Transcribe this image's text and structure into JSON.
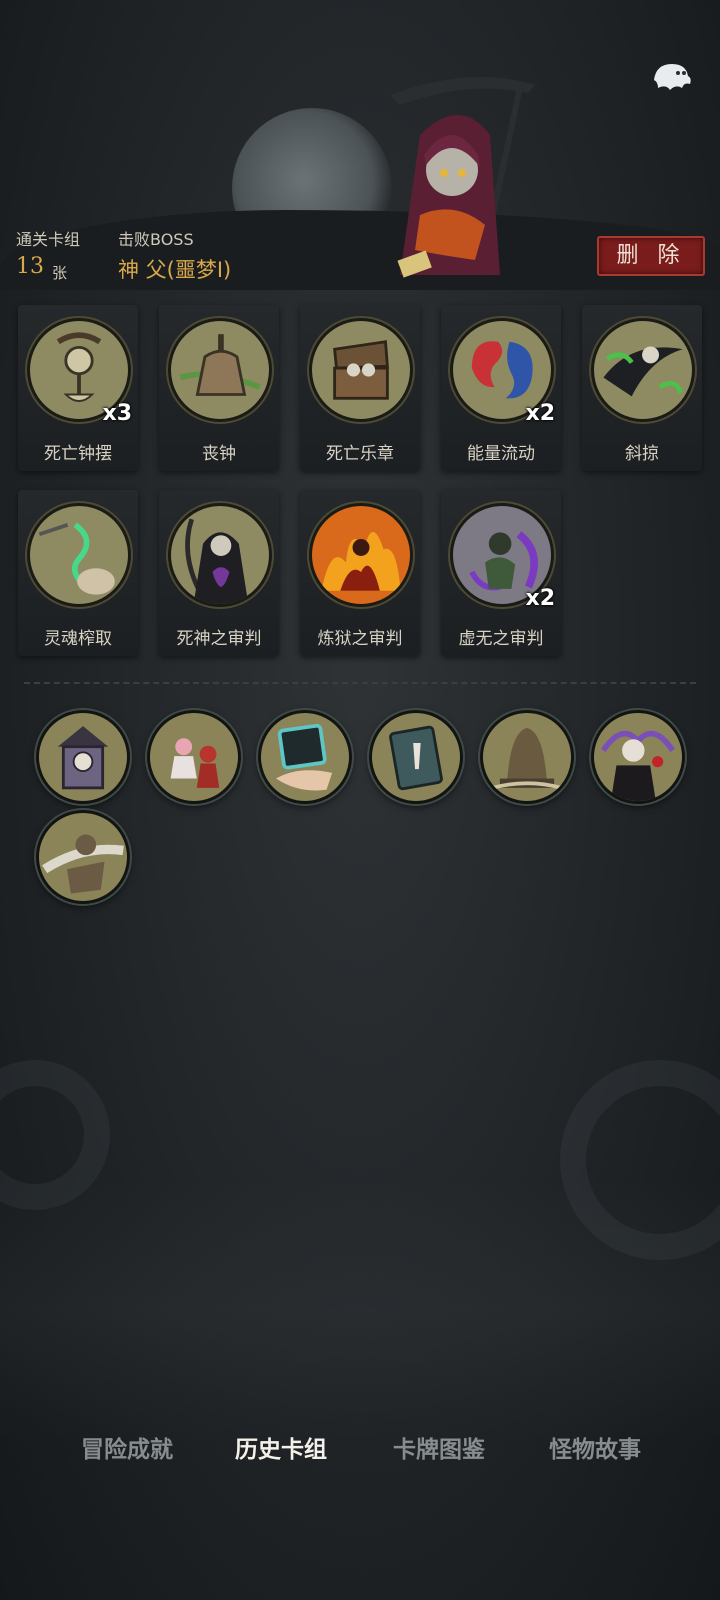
{
  "header": {
    "deck_label": "通关卡组",
    "deck_count": "13",
    "deck_unit": "张",
    "boss_label": "击败BOSS",
    "boss_name": "神 父(噩梦I)",
    "delete_label": "删 除"
  },
  "cards": [
    {
      "name": "死亡钟摆",
      "multiplier": "x3",
      "icon": "clock-pendulum-icon"
    },
    {
      "name": "丧钟",
      "multiplier": "",
      "icon": "bell-icon"
    },
    {
      "name": "死亡乐章",
      "multiplier": "",
      "icon": "chest-icon"
    },
    {
      "name": "能量流动",
      "multiplier": "x2",
      "icon": "energy-flow-icon"
    },
    {
      "name": "斜掠",
      "multiplier": "",
      "icon": "slash-icon"
    },
    {
      "name": "灵魂榨取",
      "multiplier": "",
      "icon": "soul-drain-icon"
    },
    {
      "name": "死神之审判",
      "multiplier": "",
      "icon": "reaper-icon"
    },
    {
      "name": "炼狱之审判",
      "multiplier": "",
      "icon": "inferno-icon"
    },
    {
      "name": "虚无之审判",
      "multiplier": "x2",
      "icon": "void-icon"
    }
  ],
  "relics": [
    {
      "icon": "cuckoo-clock-icon"
    },
    {
      "icon": "dancing-girls-icon"
    },
    {
      "icon": "card-hand-icon"
    },
    {
      "icon": "book-icon"
    },
    {
      "icon": "statue-icon"
    },
    {
      "icon": "vampire-icon"
    },
    {
      "icon": "monkey-icon"
    }
  ],
  "nav": {
    "tabs": [
      "冒险成就",
      "历史卡组",
      "卡牌图鉴",
      "怪物故事"
    ],
    "active_index": 1
  },
  "colors": {
    "accent_gold": "#d8a94a",
    "delete_red": "#7b1c1c",
    "card_art_bg": "#8e8a62"
  }
}
